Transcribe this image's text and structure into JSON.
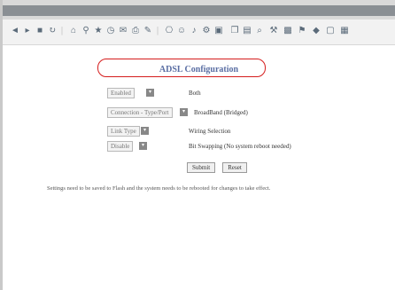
{
  "page": {
    "title": "ADSL Configuration"
  },
  "fields": [
    {
      "label": "Enabled",
      "value": "Both"
    },
    {
      "label": "Connection - Type/Port",
      "value": "BroadBand (Bridged)"
    },
    {
      "label": "Link Type",
      "value": "Wiring Selection"
    },
    {
      "label": "Disable",
      "value": "Bit Swapping (No system reboot needed)"
    }
  ],
  "actions": {
    "submit_label": "Submit",
    "reset_label": "Reset"
  },
  "footer_note": "Settings need to be saved to Flash and the system needs to be rebooted for changes to take effect.",
  "toolbar_icons": [
    "back-icon",
    "forward-icon",
    "stop-icon",
    "refresh-icon",
    "home-icon",
    "search-icon",
    "favorites-icon",
    "history-icon",
    "mail-icon",
    "print-icon",
    "edit-icon",
    "discuss-icon",
    "messenger-icon",
    "media-icon",
    "settings-icon",
    "save-icon"
  ],
  "colors": {
    "highlight": "#d51d1d",
    "title": "#5a6ea3"
  }
}
